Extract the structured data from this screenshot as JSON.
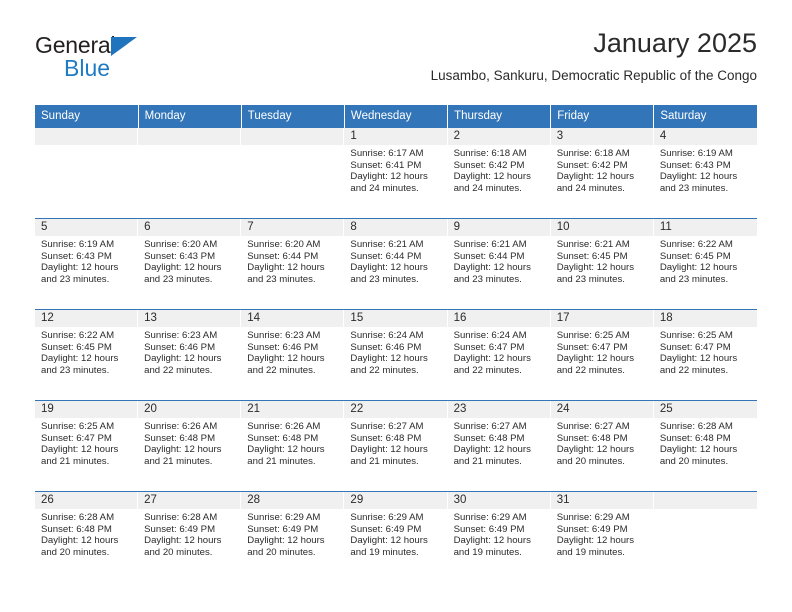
{
  "brand": {
    "name_top": "General",
    "name_bottom": "Blue"
  },
  "header": {
    "title": "January 2025",
    "subtitle": "Lusambo, Sankuru, Democratic Republic of the Congo"
  },
  "colors": {
    "header_blue": "#3275b8",
    "brand_blue": "#1f7bc4",
    "daynum_band": "#f0f0f0",
    "text": "#2b2b2b"
  },
  "weekdays": [
    "Sunday",
    "Monday",
    "Tuesday",
    "Wednesday",
    "Thursday",
    "Friday",
    "Saturday"
  ],
  "labels": {
    "sunrise": "Sunrise:",
    "sunset": "Sunset:",
    "daylight": "Daylight:"
  },
  "weeks": [
    [
      {
        "day": "",
        "lines": []
      },
      {
        "day": "",
        "lines": []
      },
      {
        "day": "",
        "lines": []
      },
      {
        "day": "1",
        "lines": [
          "Sunrise: 6:17 AM",
          "Sunset: 6:41 PM",
          "Daylight: 12 hours",
          "and 24 minutes."
        ]
      },
      {
        "day": "2",
        "lines": [
          "Sunrise: 6:18 AM",
          "Sunset: 6:42 PM",
          "Daylight: 12 hours",
          "and 24 minutes."
        ]
      },
      {
        "day": "3",
        "lines": [
          "Sunrise: 6:18 AM",
          "Sunset: 6:42 PM",
          "Daylight: 12 hours",
          "and 24 minutes."
        ]
      },
      {
        "day": "4",
        "lines": [
          "Sunrise: 6:19 AM",
          "Sunset: 6:43 PM",
          "Daylight: 12 hours",
          "and 23 minutes."
        ]
      }
    ],
    [
      {
        "day": "5",
        "lines": [
          "Sunrise: 6:19 AM",
          "Sunset: 6:43 PM",
          "Daylight: 12 hours",
          "and 23 minutes."
        ]
      },
      {
        "day": "6",
        "lines": [
          "Sunrise: 6:20 AM",
          "Sunset: 6:43 PM",
          "Daylight: 12 hours",
          "and 23 minutes."
        ]
      },
      {
        "day": "7",
        "lines": [
          "Sunrise: 6:20 AM",
          "Sunset: 6:44 PM",
          "Daylight: 12 hours",
          "and 23 minutes."
        ]
      },
      {
        "day": "8",
        "lines": [
          "Sunrise: 6:21 AM",
          "Sunset: 6:44 PM",
          "Daylight: 12 hours",
          "and 23 minutes."
        ]
      },
      {
        "day": "9",
        "lines": [
          "Sunrise: 6:21 AM",
          "Sunset: 6:44 PM",
          "Daylight: 12 hours",
          "and 23 minutes."
        ]
      },
      {
        "day": "10",
        "lines": [
          "Sunrise: 6:21 AM",
          "Sunset: 6:45 PM",
          "Daylight: 12 hours",
          "and 23 minutes."
        ]
      },
      {
        "day": "11",
        "lines": [
          "Sunrise: 6:22 AM",
          "Sunset: 6:45 PM",
          "Daylight: 12 hours",
          "and 23 minutes."
        ]
      }
    ],
    [
      {
        "day": "12",
        "lines": [
          "Sunrise: 6:22 AM",
          "Sunset: 6:45 PM",
          "Daylight: 12 hours",
          "and 23 minutes."
        ]
      },
      {
        "day": "13",
        "lines": [
          "Sunrise: 6:23 AM",
          "Sunset: 6:46 PM",
          "Daylight: 12 hours",
          "and 22 minutes."
        ]
      },
      {
        "day": "14",
        "lines": [
          "Sunrise: 6:23 AM",
          "Sunset: 6:46 PM",
          "Daylight: 12 hours",
          "and 22 minutes."
        ]
      },
      {
        "day": "15",
        "lines": [
          "Sunrise: 6:24 AM",
          "Sunset: 6:46 PM",
          "Daylight: 12 hours",
          "and 22 minutes."
        ]
      },
      {
        "day": "16",
        "lines": [
          "Sunrise: 6:24 AM",
          "Sunset: 6:47 PM",
          "Daylight: 12 hours",
          "and 22 minutes."
        ]
      },
      {
        "day": "17",
        "lines": [
          "Sunrise: 6:25 AM",
          "Sunset: 6:47 PM",
          "Daylight: 12 hours",
          "and 22 minutes."
        ]
      },
      {
        "day": "18",
        "lines": [
          "Sunrise: 6:25 AM",
          "Sunset: 6:47 PM",
          "Daylight: 12 hours",
          "and 22 minutes."
        ]
      }
    ],
    [
      {
        "day": "19",
        "lines": [
          "Sunrise: 6:25 AM",
          "Sunset: 6:47 PM",
          "Daylight: 12 hours",
          "and 21 minutes."
        ]
      },
      {
        "day": "20",
        "lines": [
          "Sunrise: 6:26 AM",
          "Sunset: 6:48 PM",
          "Daylight: 12 hours",
          "and 21 minutes."
        ]
      },
      {
        "day": "21",
        "lines": [
          "Sunrise: 6:26 AM",
          "Sunset: 6:48 PM",
          "Daylight: 12 hours",
          "and 21 minutes."
        ]
      },
      {
        "day": "22",
        "lines": [
          "Sunrise: 6:27 AM",
          "Sunset: 6:48 PM",
          "Daylight: 12 hours",
          "and 21 minutes."
        ]
      },
      {
        "day": "23",
        "lines": [
          "Sunrise: 6:27 AM",
          "Sunset: 6:48 PM",
          "Daylight: 12 hours",
          "and 21 minutes."
        ]
      },
      {
        "day": "24",
        "lines": [
          "Sunrise: 6:27 AM",
          "Sunset: 6:48 PM",
          "Daylight: 12 hours",
          "and 20 minutes."
        ]
      },
      {
        "day": "25",
        "lines": [
          "Sunrise: 6:28 AM",
          "Sunset: 6:48 PM",
          "Daylight: 12 hours",
          "and 20 minutes."
        ]
      }
    ],
    [
      {
        "day": "26",
        "lines": [
          "Sunrise: 6:28 AM",
          "Sunset: 6:48 PM",
          "Daylight: 12 hours",
          "and 20 minutes."
        ]
      },
      {
        "day": "27",
        "lines": [
          "Sunrise: 6:28 AM",
          "Sunset: 6:49 PM",
          "Daylight: 12 hours",
          "and 20 minutes."
        ]
      },
      {
        "day": "28",
        "lines": [
          "Sunrise: 6:29 AM",
          "Sunset: 6:49 PM",
          "Daylight: 12 hours",
          "and 20 minutes."
        ]
      },
      {
        "day": "29",
        "lines": [
          "Sunrise: 6:29 AM",
          "Sunset: 6:49 PM",
          "Daylight: 12 hours",
          "and 19 minutes."
        ]
      },
      {
        "day": "30",
        "lines": [
          "Sunrise: 6:29 AM",
          "Sunset: 6:49 PM",
          "Daylight: 12 hours",
          "and 19 minutes."
        ]
      },
      {
        "day": "31",
        "lines": [
          "Sunrise: 6:29 AM",
          "Sunset: 6:49 PM",
          "Daylight: 12 hours",
          "and 19 minutes."
        ]
      },
      {
        "day": "",
        "lines": []
      }
    ]
  ]
}
